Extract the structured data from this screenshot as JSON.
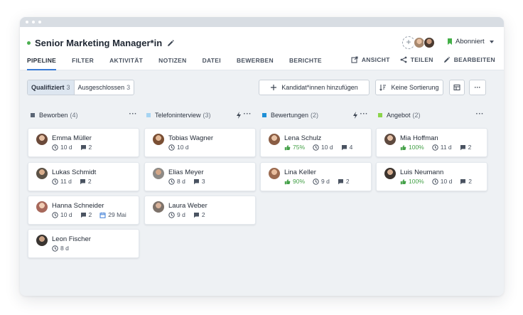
{
  "header": {
    "job_title": "Senior Marketing Manager*in",
    "subscribe_label": "Abonniert",
    "nav": [
      "PIPELINE",
      "FILTER",
      "AKTIVITÄT",
      "NOTIZEN",
      "DATEI",
      "BEWERBEN",
      "BERICHTE"
    ],
    "actions": {
      "view": "ANSICHT",
      "share": "TEILEN",
      "edit": "BEARBEITEN"
    },
    "add_member_symbol": "+"
  },
  "toolbar": {
    "qualified_label": "Qualifiziert",
    "qualified_count": "3",
    "excluded_label": "Ausgeschlossen",
    "excluded_count": "3",
    "add_candidates": "Kandidat*innen hinzufügen",
    "sorting": "Keine Sortierung",
    "more": "···"
  },
  "colors": {
    "accent": "#3a7bd5",
    "status_green": "#4caf50",
    "col_beworben": "#5b6675",
    "col_telefon": "#a6d4f2",
    "col_bewertungen": "#1e8fd6",
    "col_angebot": "#8bd44b"
  },
  "columns": [
    {
      "title": "Beworben",
      "count": "(4)",
      "has_bolt": false,
      "more": "···",
      "cards": [
        {
          "name": "Emma Müller",
          "match": "",
          "days": "10 d",
          "comments": "2",
          "date": ""
        },
        {
          "name": "Lukas Schmidt",
          "match": "",
          "days": "11 d",
          "comments": "2",
          "date": ""
        },
        {
          "name": "Hanna Schneider",
          "match": "",
          "days": "10 d",
          "comments": "2",
          "date": "29 Mai"
        },
        {
          "name": "Leon Fischer",
          "match": "",
          "days": "8 d",
          "comments": "",
          "date": ""
        }
      ]
    },
    {
      "title": "Telefoninterview",
      "count": "(3)",
      "has_bolt": true,
      "more": "···",
      "cards": [
        {
          "name": "Tobias Wagner",
          "match": "",
          "days": "10 d",
          "comments": "",
          "date": ""
        },
        {
          "name": "Elias Meyer",
          "match": "",
          "days": "8 d",
          "comments": "3",
          "date": ""
        },
        {
          "name": "Laura Weber",
          "match": "",
          "days": "9 d",
          "comments": "2",
          "date": ""
        }
      ]
    },
    {
      "title": "Bewertungen",
      "count": "(2)",
      "has_bolt": true,
      "more": "···",
      "cards": [
        {
          "name": "Lena Schulz",
          "match": "75%",
          "days": "10 d",
          "comments": "4",
          "date": ""
        },
        {
          "name": "Lina Keller",
          "match": "90%",
          "days": "9 d",
          "comments": "2",
          "date": ""
        }
      ]
    },
    {
      "title": "Angebot",
      "count": "(2)",
      "has_bolt": false,
      "more": "···",
      "cards": [
        {
          "name": "Mia Hoffman",
          "match": "100%",
          "days": "11 d",
          "comments": "2",
          "date": ""
        },
        {
          "name": "Luis Neumann",
          "match": "100%",
          "days": "10 d",
          "comments": "2",
          "date": ""
        }
      ]
    }
  ]
}
